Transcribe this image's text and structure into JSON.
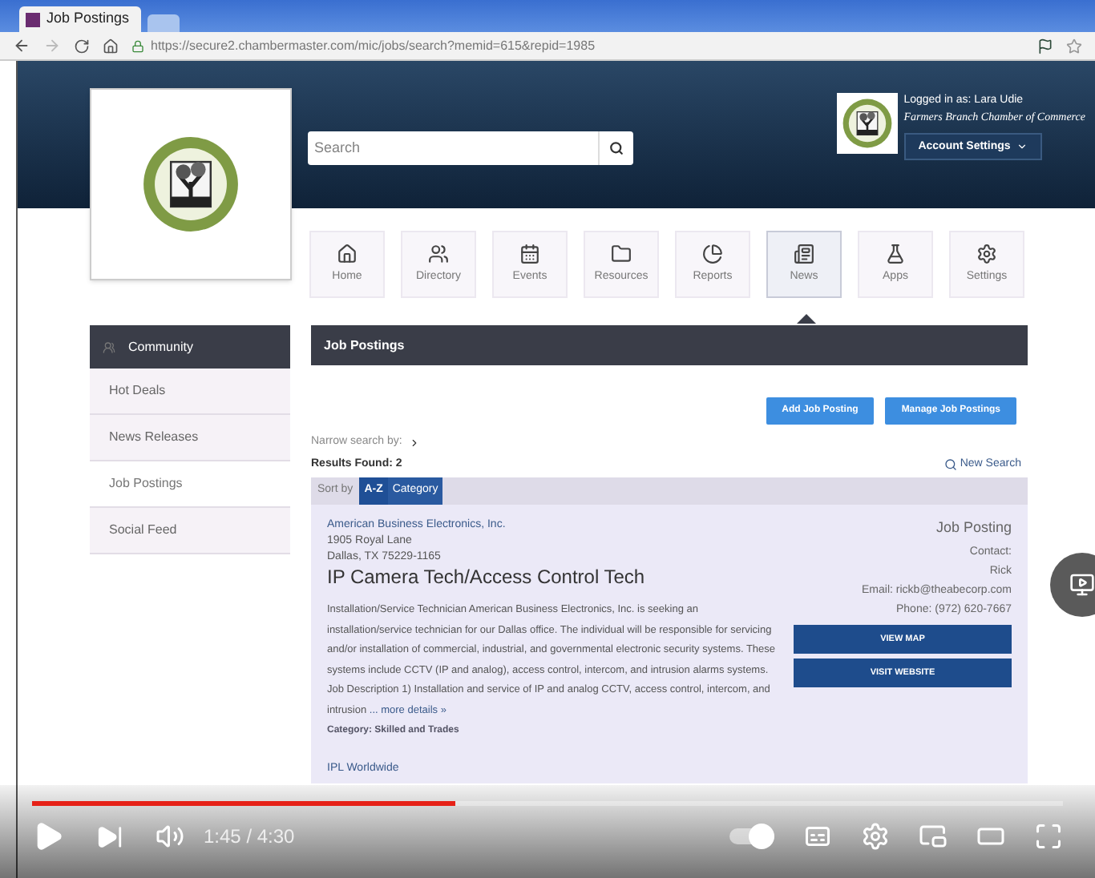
{
  "browser": {
    "tab_title": "Job Postings",
    "url": "https://secure2.chambermaster.com/mic/jobs/search?memid=615&repid=1985"
  },
  "header": {
    "search": {
      "placeholder": "Search"
    },
    "logged_in": "Logged in as: Lara Udie",
    "organization": "Farmers Branch Chamber of Commerce",
    "account_button": "Account Settings"
  },
  "nav": [
    {
      "label": "Home",
      "kind": "home",
      "selected": false
    },
    {
      "label": "Directory",
      "kind": "directory",
      "selected": false
    },
    {
      "label": "Events",
      "kind": "events",
      "selected": false
    },
    {
      "label": "Resources",
      "kind": "resources",
      "selected": false
    },
    {
      "label": "Reports",
      "kind": "reports",
      "selected": false
    },
    {
      "label": "News",
      "kind": "news",
      "selected": true
    },
    {
      "label": "Apps",
      "kind": "apps",
      "selected": false
    },
    {
      "label": "Settings",
      "kind": "settings",
      "selected": false
    }
  ],
  "sidebar": {
    "title": "Community",
    "items": [
      {
        "label": "Hot Deals",
        "selected": false
      },
      {
        "label": "News Releases",
        "selected": false
      },
      {
        "label": "Job Postings",
        "selected": true
      },
      {
        "label": "Social Feed",
        "selected": false
      }
    ]
  },
  "main": {
    "title": "Job Postings",
    "buttons": [
      "Add Job Posting",
      "Manage Job Postings"
    ],
    "narrow": "Narrow search by:",
    "results": "Results Found: 2",
    "new_search": "New Search",
    "sort_label": "Sort by",
    "sort_tabs": [
      {
        "label": "A-Z",
        "selected": true
      },
      {
        "label": "Category",
        "selected": false
      }
    ],
    "posting": {
      "company": "American Business Electronics, Inc.",
      "address": [
        "1905 Royal Lane",
        "Dallas, TX 75229-1165"
      ],
      "title": "IP Camera Tech/Access Control Tech",
      "description": "Installation/Service Technician American Business Electronics, Inc. is seeking an installation/service technician for our Dallas office. The individual will be responsible for servicing and/or installation of commercial, industrial, and governmental electronic security systems. These systems include CCTV (IP and analog), access control, intercom, and intrusion alarms systems. Job Description 1) Installation and service of IP and analog CCTV, access control, intercom, and intrusion",
      "more": "... more details »",
      "category": "Category: Skilled and Trades",
      "type": "Job Posting",
      "contact_label": "Contact:",
      "contact_name": "Rick",
      "email": "Email: rickb@theabecorp.com",
      "phone": "Phone: (972) 620-7667",
      "actions": [
        "VIEW MAP",
        "VISIT WEBSITE"
      ]
    },
    "next_company": "IPL Worldwide"
  },
  "player": {
    "level": 0.41,
    "autoplay_on": true,
    "time": "1:45 / 4:30"
  }
}
